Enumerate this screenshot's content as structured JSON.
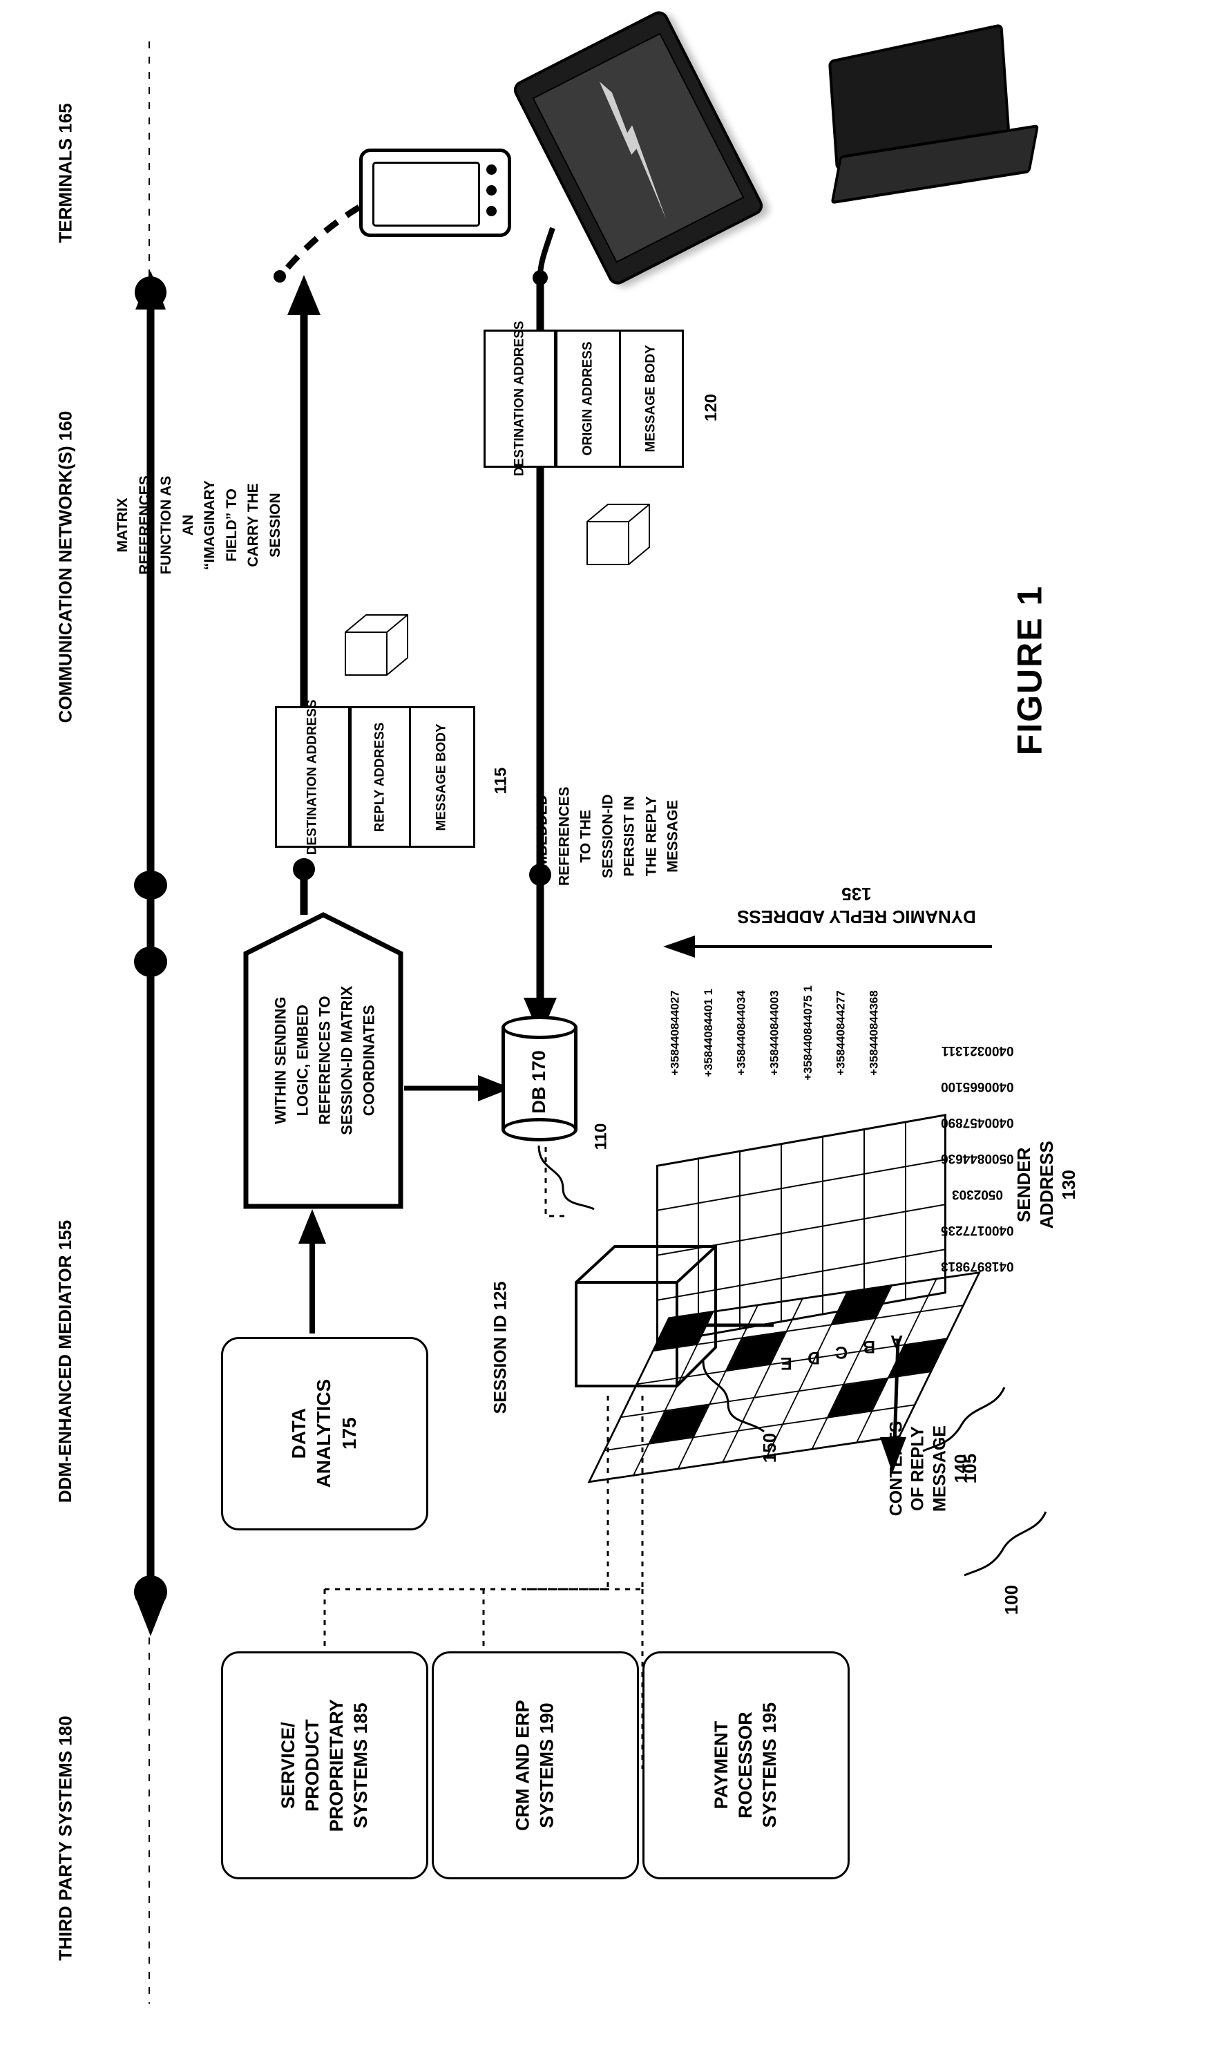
{
  "figure": {
    "title": "FIGURE 1",
    "ref_100": "100",
    "ref_105": "105",
    "ref_110": "110",
    "ref_115": "115",
    "ref_120": "120",
    "ref_150": "150"
  },
  "lanes": {
    "terminals": "TERMINALS 165",
    "network": "COMMUNICATION NETWORK(S) 160",
    "mediator": "DDM-ENHANCED MEDIATOR 155",
    "third_party": "THIRD PARTY SYSTEMS 180"
  },
  "annotations": {
    "matrix_note": "MATRIX REFERENCES FUNCTION AS AN “IMAGINARY FIELD” TO CARRY THE SESSION",
    "embedded_note": "EMBEDDED REFERENCES TO THE SESSION-ID PERSIST IN THE REPLY MESSAGE"
  },
  "message_120": {
    "label": "120",
    "fields": [
      "DESTINATION ADDRESS",
      "ORIGIN ADDRESS",
      "MESSAGE BODY"
    ]
  },
  "message_115": {
    "label": "115",
    "fields": [
      "DESTINATION ADDRESS",
      "REPLY ADDRESS",
      "MESSAGE BODY"
    ]
  },
  "pentagon": {
    "text": "WITHIN SENDING LOGIC, EMBED REFERENCES TO SESSION-ID MATRIX COORDINATES"
  },
  "database": {
    "label": "DB 170",
    "line1": "DB",
    "line2": "170"
  },
  "data_analytics": {
    "line1": "DATA",
    "line2": "ANALYTICS",
    "line3": "175"
  },
  "session_id": {
    "label": "SESSION ID 125"
  },
  "third_party_boxes": [
    {
      "id": "service-product",
      "lines": [
        "SERVICE/",
        "PRODUCT",
        "PROPRIETARY",
        "SYSTEMS 185"
      ]
    },
    {
      "id": "crm-erp",
      "lines": [
        "CRM AND ERP",
        "SYSTEMS 190"
      ]
    },
    {
      "id": "payment-processor",
      "lines": [
        "PAYMENT",
        "ROCESSOR",
        "SYSTEMS 195"
      ]
    }
  ],
  "matrix": {
    "dynamic_reply_label": "DYNAMIC REPLY ADDRESS 135",
    "sender_label": "SENDER ADDRESS 130",
    "contents_label": "CONTENTS OF REPLY MESSAGE 140",
    "ref_150": "150",
    "reply_addresses": [
      "+358440844027",
      "+35844084401 1",
      "+358440844034",
      "+358440844003",
      "+358440844075 1",
      "+358440844277",
      "+358440844368"
    ],
    "sender_addresses": [
      "0400321311",
      "0400665100",
      "0400457890",
      "0500844636",
      "0502303",
      "0400177235",
      "0418979813"
    ],
    "depth_labels": [
      "A",
      "B",
      "C",
      "D",
      "E"
    ],
    "filled_cells": [
      [
        0,
        0
      ],
      [
        0,
        4
      ],
      [
        1,
        2
      ],
      [
        3,
        1
      ],
      [
        3,
        5
      ],
      [
        4,
        6
      ]
    ]
  }
}
